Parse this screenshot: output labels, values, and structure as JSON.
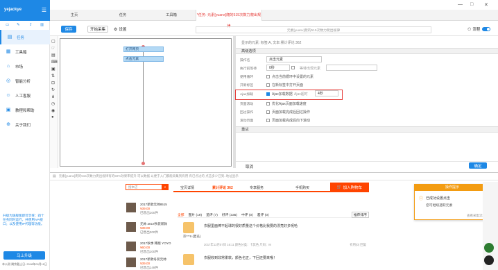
{
  "sidebar": {
    "user": "yejackye",
    "items": [
      {
        "label": "任务",
        "icon": "task-icon",
        "active": true
      },
      {
        "label": "工具箱",
        "icon": "toolbox-icon"
      },
      {
        "label": "市场",
        "icon": "market-icon"
      },
      {
        "label": "智能分析",
        "icon": "analysis-icon"
      },
      {
        "label": "人工客服",
        "icon": "customer-service-icon"
      },
      {
        "label": "教程和帮助",
        "icon": "help-icon"
      },
      {
        "label": "关于我们",
        "icon": "about-icon"
      }
    ],
    "promo": "升级为旗舰版即可享受：四个任务同时运行，并使用API接口；以及使用IP代理等功能。",
    "upgrade": "马上升级",
    "version": "本公测  剩余截止日: 2018年09月11日"
  },
  "tabs": [
    {
      "label": "主页"
    },
    {
      "label": "任务"
    },
    {
      "label": "工具箱"
    },
    {
      "label": "*任务: 元素[yuanx]爬的515次数力爬出规律",
      "active": true
    }
  ],
  "toolbar": {
    "save": "保存",
    "start": "开始采集",
    "settings": "设置",
    "url": "元素[yuanx]爬的515次数力爬出规律",
    "flow": "流程"
  },
  "flow": {
    "node1": "打开网页",
    "node2": "点击元素"
  },
  "panel": {
    "subtitle": "显示的元素: 标签:A, 文本:累计评论 362",
    "section_advanced": "高级选项",
    "name_label": "操作名",
    "name_value": "点击元素",
    "wait_label": "执行前等待",
    "wait_value": "0秒",
    "wait_hint": "等待出现元素",
    "loop_label": "使用循环",
    "loop_text": "点击当前循环中设置的元素",
    "newtab_label": "开新标签",
    "newtab_text": "在新标签中打开页面",
    "ajax_label": "Ajax加载",
    "ajax_text": "Ajax加载数据",
    "ajax_timeout_label": "Ajax超时",
    "ajax_timeout_value": "4秒",
    "scroll_label": "页面滚动",
    "scroll_text": "优化Ajax页面加载速度",
    "nav_label": "回过操作",
    "nav_text": "页面加载完成后回过操作",
    "anchor_label": "滚动页面",
    "anchor_text": "页面加载完成后向下滚动",
    "section_retry": "重试",
    "cancel": "取消",
    "confirm": "确定"
  },
  "browser": {
    "address": "元素[yuanx]爬的515次数力爬出规律有的50%效果率提升 可以数据 以便于入门都能采集到有用 有已点过的 点击多少已到..地址显示",
    "search_placeholder": "搜本店",
    "shop_tabs": [
      "宝贝详情",
      "累计评论 362",
      "专享服务"
    ],
    "mobile_buy": "手机购买",
    "add_cart": "加入购物车",
    "products": [
      {
        "title": "2017新款元帅8515",
        "price": "¥39.00",
        "sold": "已售出100件"
      },
      {
        "title": "元帅 2017秋装新款",
        "price": "¥39.00",
        "sold": "已售出200件"
      },
      {
        "title": "2017秋季 韩版 YOYO",
        "price": "¥60.00",
        "sold": "已售出100件"
      },
      {
        "title": "2017新款冬装元帅",
        "price": "¥39.00",
        "sold": "已售出149件"
      }
    ],
    "filter": {
      "all": "全部",
      "with_pic": "图片 (19)",
      "append": "追评 (7)",
      "good": "好评 (335)",
      "mid": "中评 (0)",
      "bad": "差评 (0)",
      "sort": "推荐排序"
    },
    "reviews": [
      {
        "user": "宗***9 (匿名)",
        "text": "衣服里面棒不起球的很好质量这个价格比我要的漂亮好多呢哈",
        "meta": "2017年12月07日 16:11  颜色分类：卡其色  尺码：M",
        "actions": "有用(0)  回复"
      },
      {
        "user": "",
        "text": "衣服收到非常柔软，颜色也正，下回还要来哦！",
        "meta": "",
        "actions": ""
      }
    ],
    "popup": {
      "title": "操作提示",
      "line1": "已成功设置点击",
      "line2": "您可继续选取元素",
      "link": "查看采集流程"
    }
  }
}
